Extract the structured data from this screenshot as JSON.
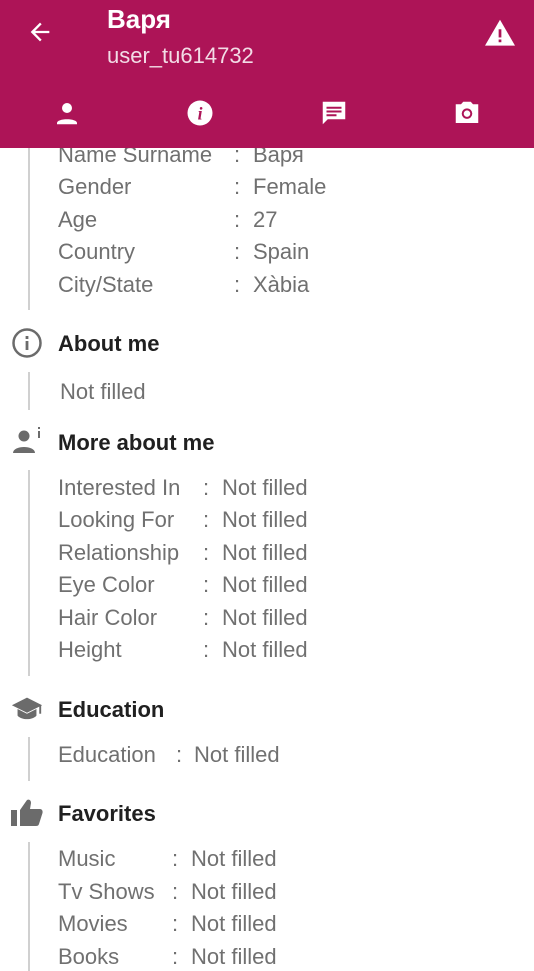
{
  "colors": {
    "accent": "#ad1457",
    "label": "#707070",
    "heading": "#202020"
  },
  "header": {
    "title": "Варя",
    "subtitle": "user_tu614732",
    "icons": {
      "back": "arrow-left-icon",
      "report": "warning-icon"
    },
    "tabs": [
      {
        "icon": "person-icon"
      },
      {
        "icon": "info-icon"
      },
      {
        "icon": "chat-icon"
      },
      {
        "icon": "camera-icon"
      }
    ]
  },
  "basic": {
    "rows": [
      {
        "label": "Name Surname",
        "sep": ":",
        "value": "Варя"
      },
      {
        "label": "Gender",
        "sep": ":",
        "value": "Female"
      },
      {
        "label": "Age",
        "sep": ":",
        "value": "27"
      },
      {
        "label": "Country",
        "sep": ":",
        "value": "Spain"
      },
      {
        "label": "City/State",
        "sep": ":",
        "value": "Xàbia"
      }
    ]
  },
  "about": {
    "title": "About me",
    "value": "Not filled"
  },
  "more": {
    "title": "More about me",
    "rows": [
      {
        "label": "Interested In",
        "sep": ":",
        "value": "Not filled"
      },
      {
        "label": "Looking For",
        "sep": ":",
        "value": "Not filled"
      },
      {
        "label": "Relationship",
        "sep": ":",
        "value": "Not filled"
      },
      {
        "label": "Eye Color",
        "sep": ":",
        "value": "Not filled"
      },
      {
        "label": "Hair Color",
        "sep": ":",
        "value": "Not filled"
      },
      {
        "label": "Height",
        "sep": ":",
        "value": "Not filled"
      }
    ]
  },
  "education": {
    "title": "Education",
    "rows": [
      {
        "label": "Education",
        "sep": ":",
        "value": "Not filled"
      }
    ]
  },
  "favorites": {
    "title": "Favorites",
    "rows": [
      {
        "label": "Music",
        "sep": ":",
        "value": "Not filled"
      },
      {
        "label": "Tv Shows",
        "sep": ":",
        "value": "Not filled"
      },
      {
        "label": "Movies",
        "sep": ":",
        "value": "Not filled"
      },
      {
        "label": "Books",
        "sep": ":",
        "value": "Not filled"
      }
    ]
  }
}
